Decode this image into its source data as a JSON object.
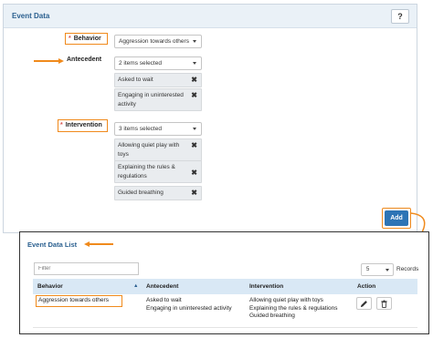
{
  "event_data": {
    "title": "Event Data",
    "help_label": "?",
    "behavior": {
      "label": "Behavior",
      "required_mark": "*",
      "selected": "Aggression towards others"
    },
    "antecedent": {
      "label": "Antecedent",
      "selected": "2 items selected",
      "chips": [
        "Asked to wait",
        "Engaging in uninterested activity"
      ]
    },
    "intervention": {
      "label": "Intervention",
      "required_mark": "*",
      "selected": "3 items selected",
      "chips": [
        "Allowing quiet play with toys",
        "Explaining the rules & regulations",
        "Guided breathing"
      ]
    },
    "remove_glyph": "✖",
    "add_label": "Add"
  },
  "event_list": {
    "title": "Event Data List",
    "filter_placeholder": "Filter",
    "page_size": "5",
    "records_label": "Records",
    "columns": [
      "Behavior",
      "Antecedent",
      "Intervention",
      "Action"
    ],
    "sort_glyph": "▲",
    "rows": [
      {
        "behavior": "Aggression towards others",
        "antecedent": [
          "Asked to wait",
          "Engaging in uninterested activity"
        ],
        "intervention": [
          "Allowing quiet play with toys",
          "Explaining the rules & regulations",
          "Guided breathing"
        ]
      }
    ],
    "edit_icon": "pencil-icon",
    "delete_icon": "trash-icon"
  },
  "colors": {
    "accent": "#2d74b5",
    "highlight": "#f08a1c",
    "header_bg": "#eaf1f7",
    "table_head_bg": "#d9e8f5",
    "required": "#d9534f"
  }
}
